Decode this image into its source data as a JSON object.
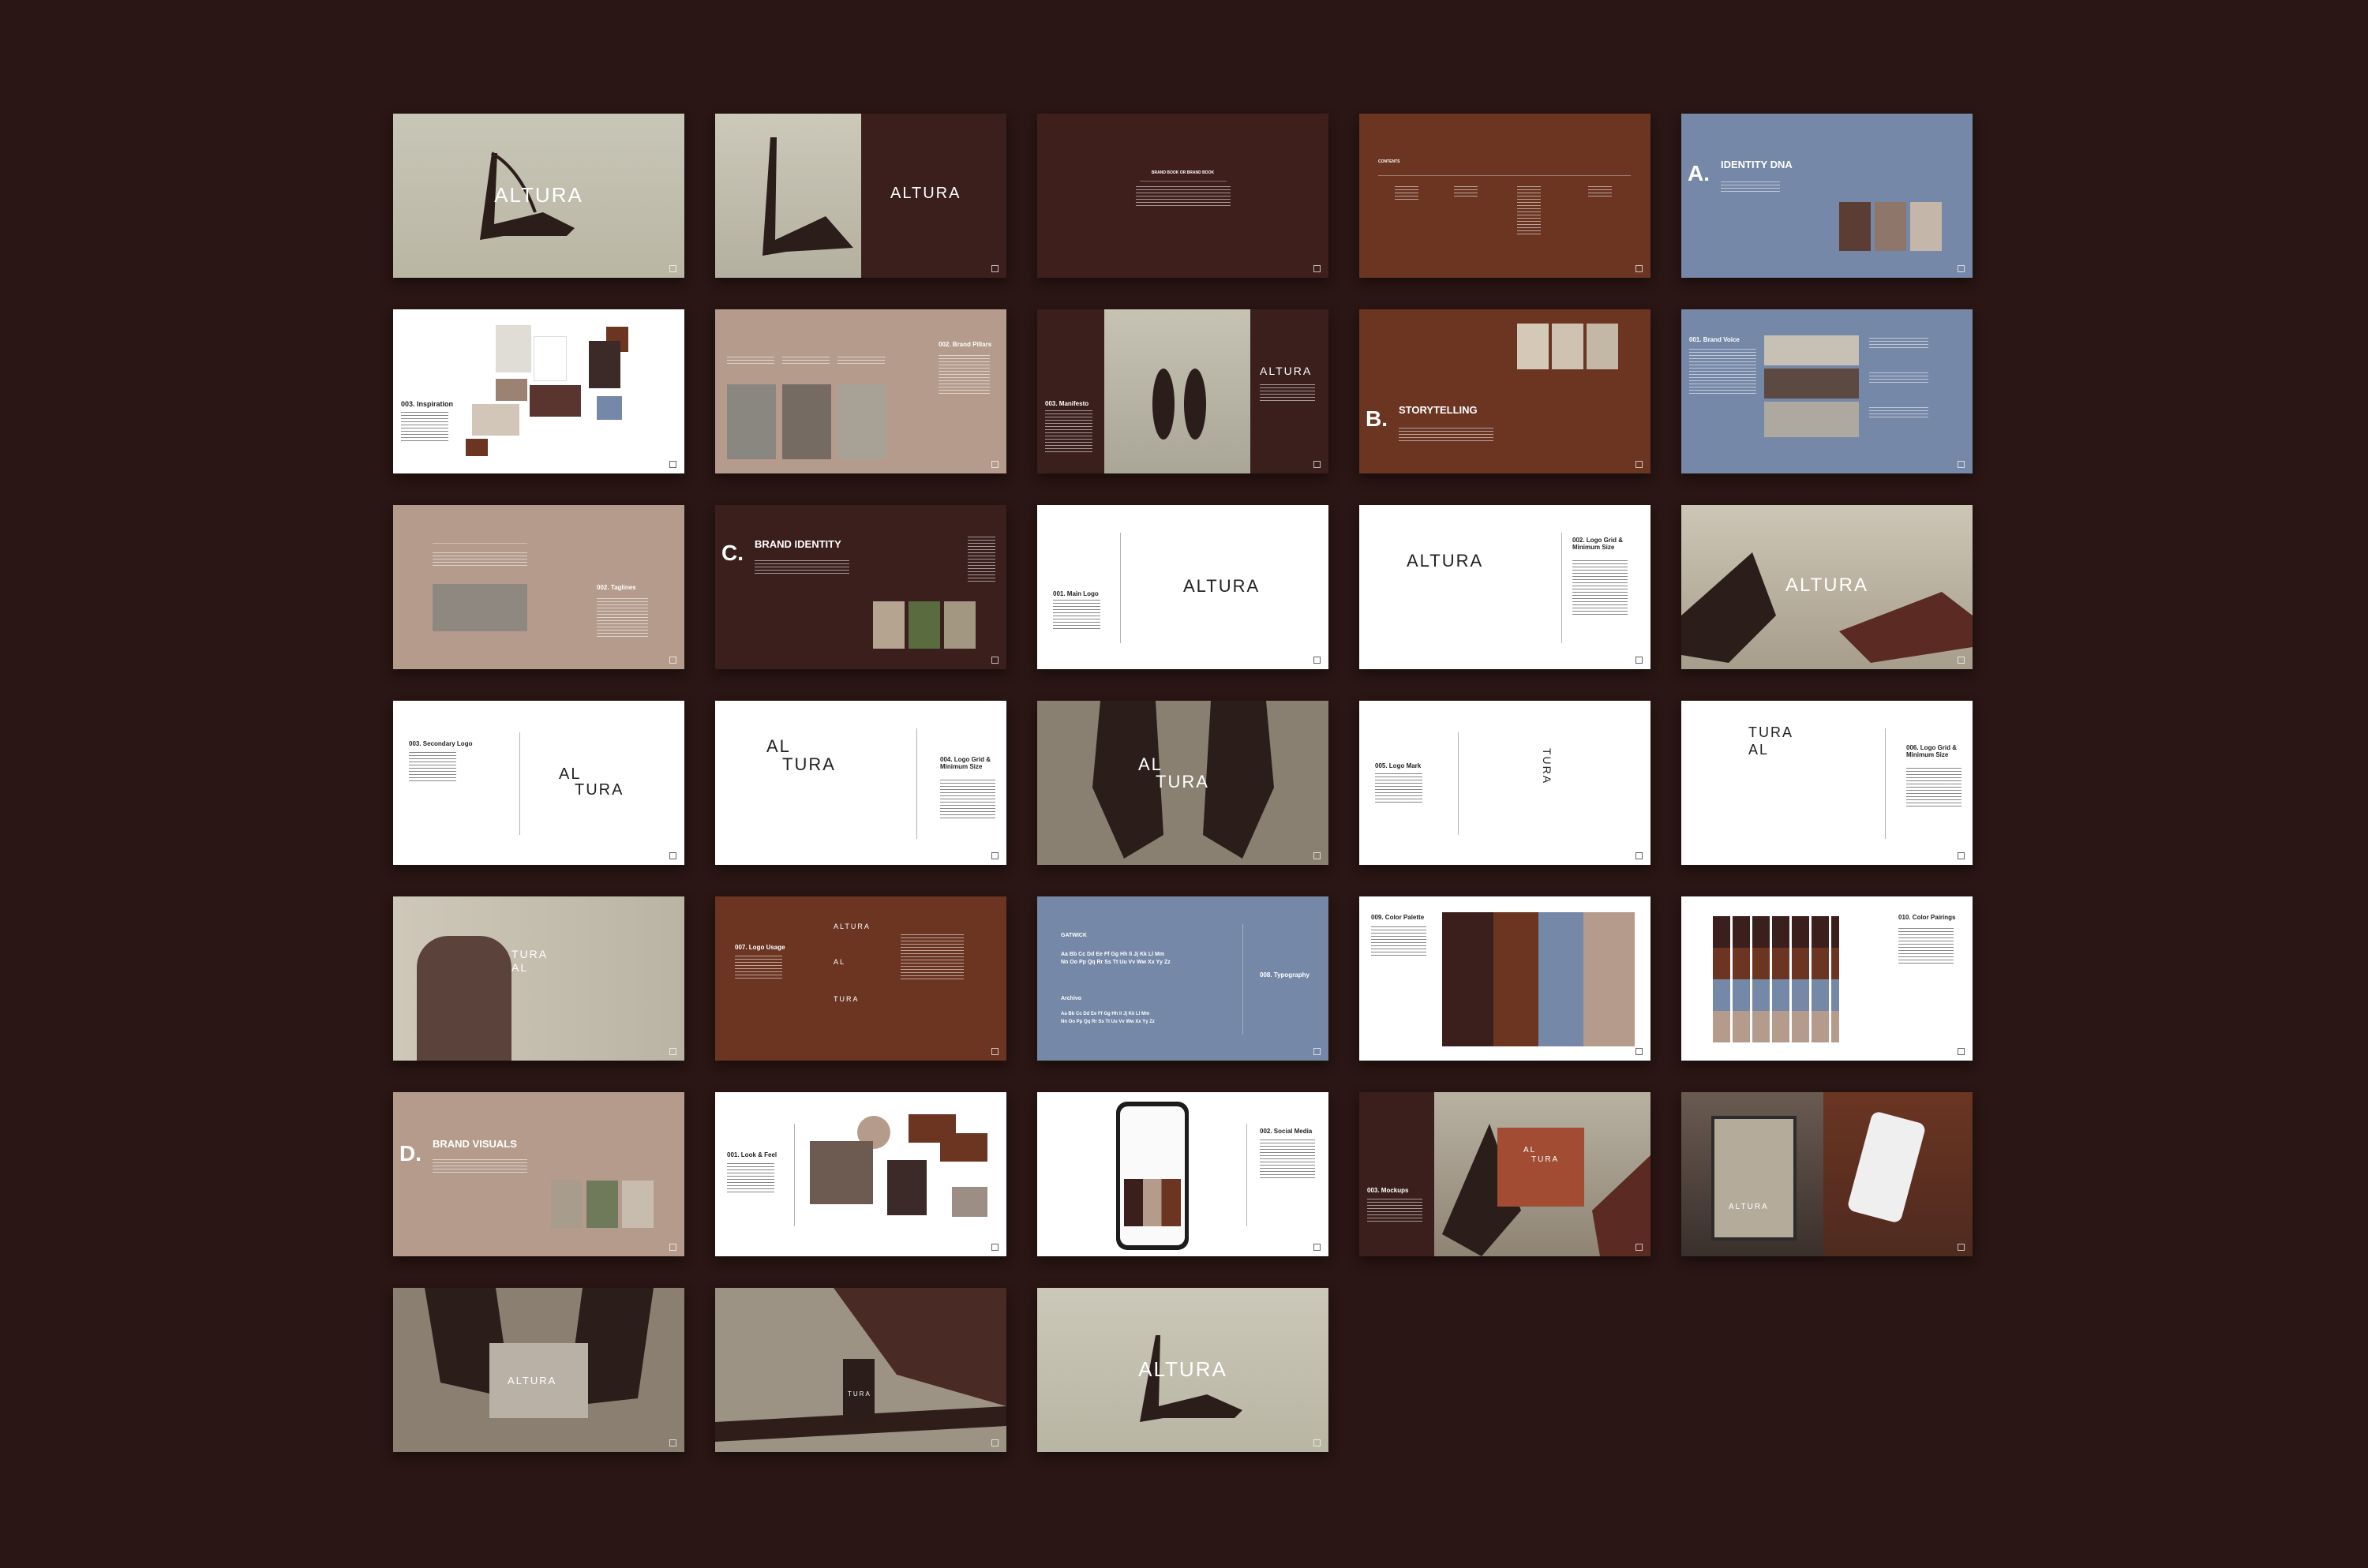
{
  "brand": "ALTURA",
  "brand_split": [
    "AL",
    "TURA"
  ],
  "colors": {
    "background": "#2a1614",
    "olive": "#c9c6b6",
    "dark_brown": "#3b1f1c",
    "rust": "#6b3522",
    "blue": "#7588a8",
    "taupe": "#b59b8c",
    "white": "#ffffff"
  },
  "sections": {
    "a": {
      "letter": "A.",
      "title": "IDENTITY DNA"
    },
    "b": {
      "letter": "B.",
      "title": "STORYTELLING"
    },
    "c": {
      "letter": "C.",
      "title": "BRAND IDENTITY"
    },
    "d": {
      "letter": "D.",
      "title": "BRAND VISUALS"
    }
  },
  "slides": {
    "brand_book": "BRAND BOOK OR BRAND BOOK",
    "contents": "CONTENTS",
    "inspiration": "003. Inspiration",
    "pillars": "002. Brand Pillars",
    "manifesto": "003. Manifesto",
    "voice": "001. Brand Voice",
    "taglines": "002. Taglines",
    "main_logo": "001. Main Logo",
    "grid_a": "002. Logo Grid & Minimum Size",
    "secondary": "003. Secondary Logo",
    "grid_b": "004. Logo Grid & Minimum Size",
    "logo_mark": "005. Logo Mark",
    "grid_c": "006. Logo Grid & Minimum Size",
    "usage": "007. Logo Usage",
    "typography": "008. Typography",
    "font_a": "GATWICK",
    "font_b": "Archivo",
    "alphabet_1": "Aa Bb Cc Dd Ee Ff Gg Hh Ii Jj Kk Ll Mm",
    "alphabet_2": "Nn Oo Pp Qq Rr Ss Tt Uu Vv Ww Xx Yy Zz",
    "palette": "009. Color Palette",
    "pairings": "010. Color Pairings",
    "look": "001. Look & Feel",
    "social": "002. Social Media",
    "mockups": "003. Mockups"
  }
}
